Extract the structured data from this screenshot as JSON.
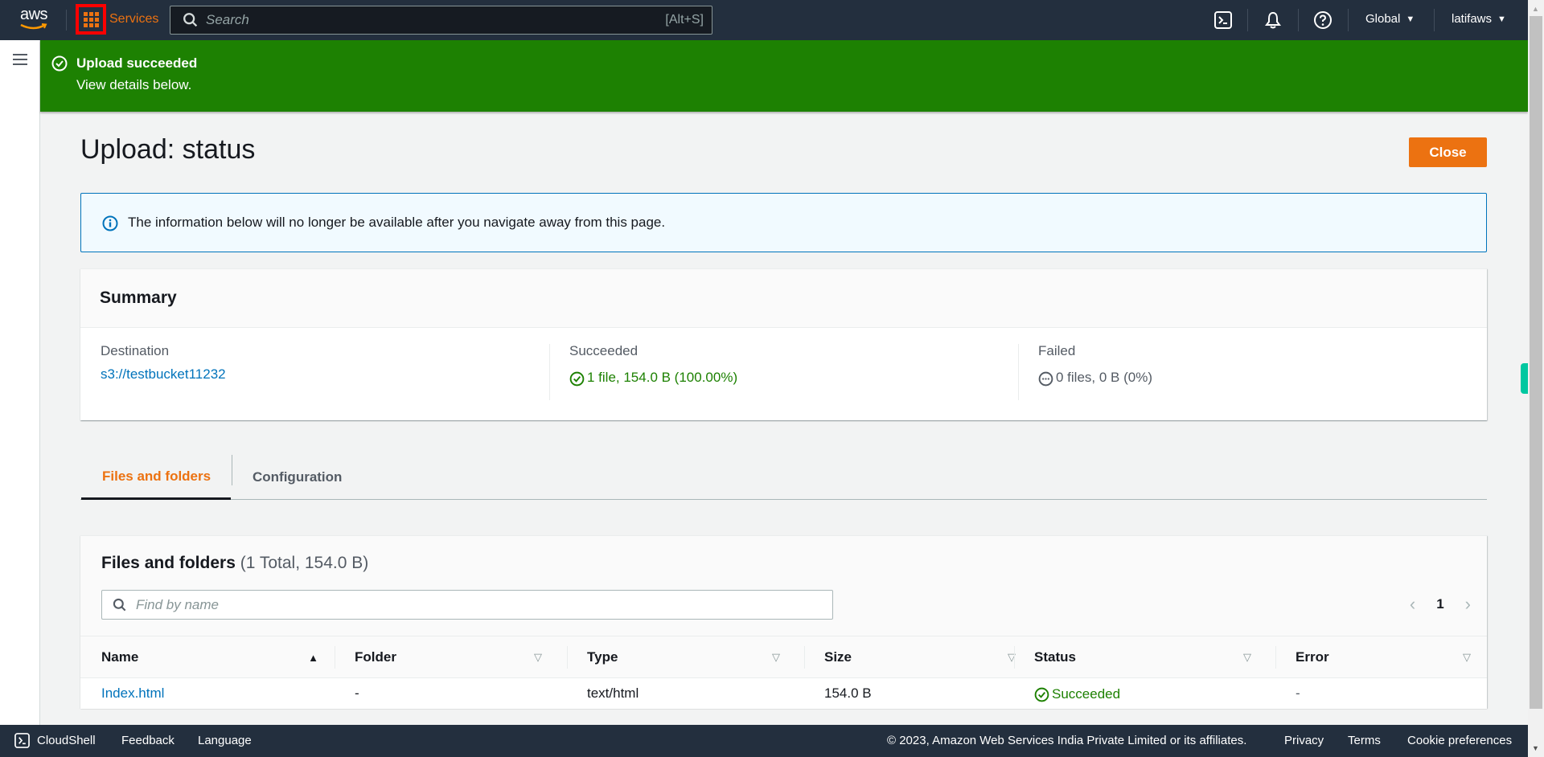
{
  "topnav": {
    "logo_text": "aws",
    "services_label": "Services",
    "search_placeholder": "Search",
    "search_shortcut": "[Alt+S]",
    "icons": [
      "cloudshell-icon",
      "bell-icon",
      "help-icon"
    ],
    "region_label": "Global",
    "account_label": "latifaws"
  },
  "flash": {
    "title": "Upload succeeded",
    "message": "View details below.",
    "type": "success",
    "color": "#1d8102"
  },
  "page": {
    "title": "Upload: status",
    "close_label": "Close",
    "accent_color": "#ec7211"
  },
  "info_alert": {
    "text": "The information below will no longer be available after you navigate away from this page."
  },
  "summary": {
    "heading": "Summary",
    "destination": {
      "label": "Destination",
      "value": "s3://testbucket11232"
    },
    "succeeded": {
      "label": "Succeeded",
      "value": "1 file, 154.0 B (100.00%)"
    },
    "failed": {
      "label": "Failed",
      "value": "0 files, 0 B (0%)"
    }
  },
  "tabs": [
    {
      "label": "Files and folders",
      "active": true
    },
    {
      "label": "Configuration",
      "active": false
    }
  ],
  "files": {
    "heading": "Files and folders",
    "count": "(1 Total, 154.0 B)",
    "find_placeholder": "Find by name",
    "page": "1",
    "columns": [
      {
        "label": "Name",
        "sort": "ascending"
      },
      {
        "label": "Folder",
        "sort": "none"
      },
      {
        "label": "Type",
        "sort": "none"
      },
      {
        "label": "Size",
        "sort": "none"
      },
      {
        "label": "Status",
        "sort": "none"
      },
      {
        "label": "Error",
        "sort": "none"
      }
    ],
    "rows": [
      {
        "name": "Index.html",
        "folder": "-",
        "type": "text/html",
        "size": "154.0 B",
        "status": "Succeeded",
        "error": "-"
      }
    ]
  },
  "footer": {
    "cloudshell": "CloudShell",
    "feedback": "Feedback",
    "language": "Language",
    "copyright": "© 2023, Amazon Web Services India Private Limited or its affiliates.",
    "privacy": "Privacy",
    "terms": "Terms",
    "cookies": "Cookie preferences"
  }
}
